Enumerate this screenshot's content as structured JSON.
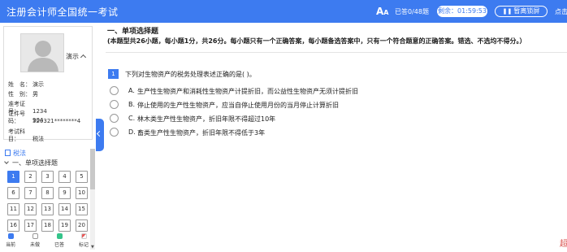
{
  "header": {
    "title": "注册会计师全国统一考试",
    "font_icon": "A",
    "font_icon_small": "A",
    "answered": "已答0/48题",
    "remaining": "剩余：01:59:53",
    "leave_label": "暂离锁屏",
    "cut_text": "点击"
  },
  "profile": {
    "name_display": "演示",
    "fields": [
      {
        "label": "姓　名：",
        "value": "演示"
      },
      {
        "label": "性　别：",
        "value": "男"
      },
      {
        "label": "准考证号：",
        "value": "1234"
      },
      {
        "label": "证件号码：",
        "value": "320321********4"
      },
      {
        "label": "",
        "value": "904"
      },
      {
        "label": "考试科目：",
        "value": "税法"
      }
    ]
  },
  "nav": {
    "subject": "税法",
    "section": "一、单项选择题",
    "questions": [
      "1",
      "2",
      "3",
      "4",
      "5",
      "6",
      "7",
      "8",
      "9",
      "10",
      "11",
      "12",
      "13",
      "14",
      "15",
      "16",
      "17",
      "18",
      "19",
      "20"
    ],
    "current": "1"
  },
  "legend": [
    {
      "label": "当前",
      "color": "#3d7bf0"
    },
    {
      "label": "未做",
      "color": "#ffffff"
    },
    {
      "label": "已答",
      "color": "#35c48a"
    },
    {
      "label": "标记",
      "color": "#e85b5b"
    }
  ],
  "exam": {
    "section_title": "一、单项选择题",
    "instructions": "(本题型共26小题，每小题1分，共26分。每小题只有一个正确答案，每小题备选答案中，只有一个符合题意的正确答案。错选、不选均不得分。）",
    "question_number": "1",
    "question_text": "下列对生物资产的税务处理表述正确的是(   )。",
    "options": [
      {
        "letter": "A.",
        "text": "生产性生物资产和消耗性生物资产计提折旧，而公益性生物资产无须计提折旧"
      },
      {
        "letter": "B.",
        "text": "停止使用的生产性生物资产，应当自停止使用月份的当月停止计算折旧"
      },
      {
        "letter": "C.",
        "text": "林木类生产性生物资产，折旧年限不得超过10年"
      },
      {
        "letter": "D.",
        "text": "畜类生产性生物资产，折旧年限不得低于3年"
      }
    ],
    "corner_char": "超"
  }
}
